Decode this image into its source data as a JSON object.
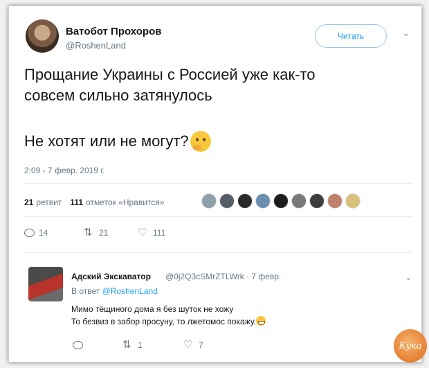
{
  "tweet": {
    "author_name": "Ватобот Прохоров",
    "author_handle": "@RoshenLand",
    "follow_label": "Читать",
    "text_line1": "Прощание Украины с Россией уже как-то",
    "text_line2": "совсем сильно затянулось",
    "text_question": "Не хотят или не могут?",
    "emoji": "thinking-face",
    "timestamp": "2:09 - 7 февр. 2019 г.",
    "retweets_count": "21",
    "retweets_label": "ретвит",
    "likes_count": "111",
    "likes_label": "отметок «Нравится»",
    "liker_avatars": [
      {
        "color": "#8fa0a8"
      },
      {
        "color": "#555e66"
      },
      {
        "color": "#2a2a2a"
      },
      {
        "color": "#6b8fb0"
      },
      {
        "color": "#1d1d1d"
      },
      {
        "color": "#7a7a7a"
      },
      {
        "color": "#3d3d3d"
      },
      {
        "color": "#c0806a"
      },
      {
        "color": "#d8c27a"
      }
    ],
    "actions": {
      "reply_count": "14",
      "retweet_count": "21",
      "like_count": "111"
    }
  },
  "reply": {
    "author_name": "Адский Экскаватор",
    "author_handle": "@0j2Q3cSMrZTLWrk · 7 февр.",
    "reply_to_prefix": "В ответ",
    "reply_to_handle": "@RoshenLand",
    "text_line1": "Мимо тёщиного дома я без шуток не хожу",
    "text_line2": "То безвиз в забор просуну, то лжетомос покажу.",
    "emoji": "grinning-face",
    "actions": {
      "reply_count": "",
      "retweet_count": "1",
      "like_count": "7"
    }
  },
  "watermark": {
    "text": "Кука"
  },
  "colors": {
    "accent": "#1da1f2",
    "muted": "#657786"
  }
}
